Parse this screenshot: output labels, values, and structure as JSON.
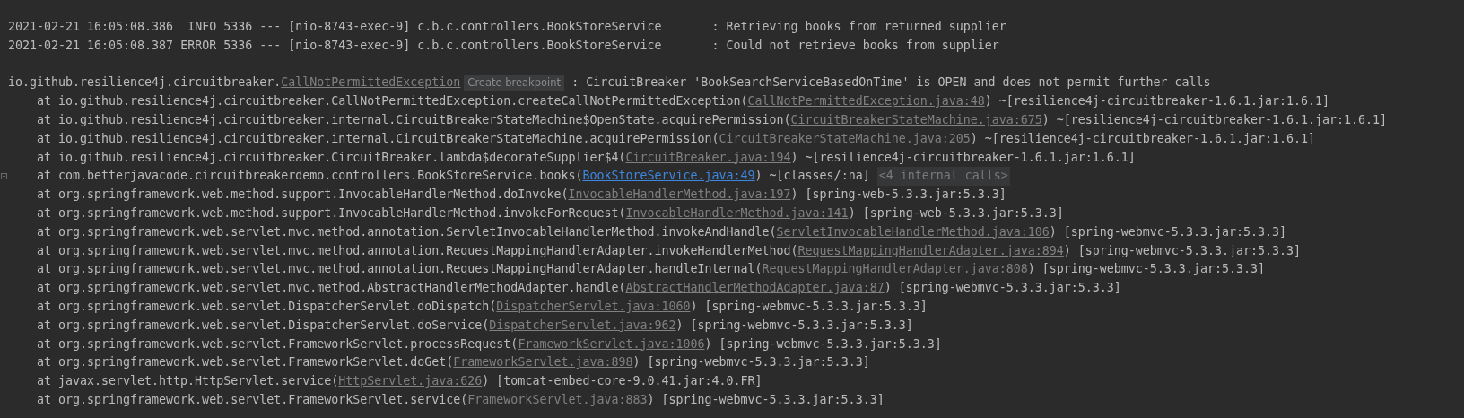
{
  "console": {
    "lines": [
      {
        "kind": "log",
        "segments": [
          {
            "kind": "plain",
            "text": "2021-02-21 16:05:08.386  INFO 5336 --- [nio-8743-exec-9] c.b.c.controllers.BookStoreService       : Retrieving books from returned supplier"
          }
        ]
      },
      {
        "kind": "log",
        "segments": [
          {
            "kind": "plain",
            "text": "2021-02-21 16:05:08.387 ERROR 5336 --- [nio-8743-exec-9] c.b.c.controllers.BookStoreService       : Could not retrieve books from supplier"
          }
        ]
      },
      {
        "kind": "exception",
        "segments": [
          {
            "kind": "plain",
            "text": "io.github.resilience4j.circuitbreaker."
          },
          {
            "kind": "link",
            "text": "CallNotPermittedException"
          },
          {
            "kind": "badge",
            "text": "Create breakpoint"
          },
          {
            "kind": "plain",
            "text": " : CircuitBreaker 'BookSearchServiceBasedOnTime' is OPEN and does not permit further calls"
          }
        ]
      },
      {
        "kind": "frame",
        "segments": [
          {
            "kind": "plain",
            "text": "at io.github.resilience4j.circuitbreaker.CallNotPermittedException.createCallNotPermittedException("
          },
          {
            "kind": "link",
            "text": "CallNotPermittedException.java:48"
          },
          {
            "kind": "plain",
            "text": ") ~[resilience4j-circuitbreaker-1.6.1.jar:1.6.1]"
          }
        ]
      },
      {
        "kind": "frame",
        "segments": [
          {
            "kind": "plain",
            "text": "at io.github.resilience4j.circuitbreaker.internal.CircuitBreakerStateMachine$OpenState.acquirePermission("
          },
          {
            "kind": "link",
            "text": "CircuitBreakerStateMachine.java:675"
          },
          {
            "kind": "plain",
            "text": ") ~[resilience4j-circuitbreaker-1.6.1.jar:1.6.1]"
          }
        ]
      },
      {
        "kind": "frame",
        "segments": [
          {
            "kind": "plain",
            "text": "at io.github.resilience4j.circuitbreaker.internal.CircuitBreakerStateMachine.acquirePermission("
          },
          {
            "kind": "link",
            "text": "CircuitBreakerStateMachine.java:205"
          },
          {
            "kind": "plain",
            "text": ") ~[resilience4j-circuitbreaker-1.6.1.jar:1.6.1]"
          }
        ]
      },
      {
        "kind": "frame",
        "segments": [
          {
            "kind": "plain",
            "text": "at io.github.resilience4j.circuitbreaker.CircuitBreaker.lambda$decorateSupplier$4("
          },
          {
            "kind": "link",
            "text": "CircuitBreaker.java:194"
          },
          {
            "kind": "plain",
            "text": ") ~[resilience4j-circuitbreaker-1.6.1.jar:1.6.1]"
          }
        ]
      },
      {
        "kind": "frame",
        "foldable": true,
        "segments": [
          {
            "kind": "plain",
            "text": "at com.betterjavacode.circuitbreakerdemo.controllers.BookStoreService.books("
          },
          {
            "kind": "project-link",
            "text": "BookStoreService.java:49"
          },
          {
            "kind": "plain",
            "text": ") ~[classes/:na] "
          },
          {
            "kind": "folded",
            "text": "<4 internal calls>"
          }
        ]
      },
      {
        "kind": "frame",
        "segments": [
          {
            "kind": "plain",
            "text": "at org.springframework.web.method.support.InvocableHandlerMethod.doInvoke("
          },
          {
            "kind": "link",
            "text": "InvocableHandlerMethod.java:197"
          },
          {
            "kind": "plain",
            "text": ") [spring-web-5.3.3.jar:5.3.3]"
          }
        ]
      },
      {
        "kind": "frame",
        "segments": [
          {
            "kind": "plain",
            "text": "at org.springframework.web.method.support.InvocableHandlerMethod.invokeForRequest("
          },
          {
            "kind": "link",
            "text": "InvocableHandlerMethod.java:141"
          },
          {
            "kind": "plain",
            "text": ") [spring-web-5.3.3.jar:5.3.3]"
          }
        ]
      },
      {
        "kind": "frame",
        "segments": [
          {
            "kind": "plain",
            "text": "at org.springframework.web.servlet.mvc.method.annotation.ServletInvocableHandlerMethod.invokeAndHandle("
          },
          {
            "kind": "link",
            "text": "ServletInvocableHandlerMethod.java:106"
          },
          {
            "kind": "plain",
            "text": ") [spring-webmvc-5.3.3.jar:5.3.3]"
          }
        ]
      },
      {
        "kind": "frame",
        "segments": [
          {
            "kind": "plain",
            "text": "at org.springframework.web.servlet.mvc.method.annotation.RequestMappingHandlerAdapter.invokeHandlerMethod("
          },
          {
            "kind": "link",
            "text": "RequestMappingHandlerAdapter.java:894"
          },
          {
            "kind": "plain",
            "text": ") [spring-webmvc-5.3.3.jar:5.3.3]"
          }
        ]
      },
      {
        "kind": "frame",
        "segments": [
          {
            "kind": "plain",
            "text": "at org.springframework.web.servlet.mvc.method.annotation.RequestMappingHandlerAdapter.handleInternal("
          },
          {
            "kind": "link",
            "text": "RequestMappingHandlerAdapter.java:808"
          },
          {
            "kind": "plain",
            "text": ") [spring-webmvc-5.3.3.jar:5.3.3]"
          }
        ]
      },
      {
        "kind": "frame",
        "segments": [
          {
            "kind": "plain",
            "text": "at org.springframework.web.servlet.mvc.method.AbstractHandlerMethodAdapter.handle("
          },
          {
            "kind": "link",
            "text": "AbstractHandlerMethodAdapter.java:87"
          },
          {
            "kind": "plain",
            "text": ") [spring-webmvc-5.3.3.jar:5.3.3]"
          }
        ]
      },
      {
        "kind": "frame",
        "segments": [
          {
            "kind": "plain",
            "text": "at org.springframework.web.servlet.DispatcherServlet.doDispatch("
          },
          {
            "kind": "link",
            "text": "DispatcherServlet.java:1060"
          },
          {
            "kind": "plain",
            "text": ") [spring-webmvc-5.3.3.jar:5.3.3]"
          }
        ]
      },
      {
        "kind": "frame",
        "segments": [
          {
            "kind": "plain",
            "text": "at org.springframework.web.servlet.DispatcherServlet.doService("
          },
          {
            "kind": "link",
            "text": "DispatcherServlet.java:962"
          },
          {
            "kind": "plain",
            "text": ") [spring-webmvc-5.3.3.jar:5.3.3]"
          }
        ]
      },
      {
        "kind": "frame",
        "segments": [
          {
            "kind": "plain",
            "text": "at org.springframework.web.servlet.FrameworkServlet.processRequest("
          },
          {
            "kind": "link",
            "text": "FrameworkServlet.java:1006"
          },
          {
            "kind": "plain",
            "text": ") [spring-webmvc-5.3.3.jar:5.3.3]"
          }
        ]
      },
      {
        "kind": "frame",
        "segments": [
          {
            "kind": "plain",
            "text": "at org.springframework.web.servlet.FrameworkServlet.doGet("
          },
          {
            "kind": "link",
            "text": "FrameworkServlet.java:898"
          },
          {
            "kind": "plain",
            "text": ") [spring-webmvc-5.3.3.jar:5.3.3]"
          }
        ]
      },
      {
        "kind": "frame",
        "segments": [
          {
            "kind": "plain",
            "text": "at javax.servlet.http.HttpServlet.service("
          },
          {
            "kind": "link",
            "text": "HttpServlet.java:626"
          },
          {
            "kind": "plain",
            "text": ") [tomcat-embed-core-9.0.41.jar:4.0.FR]"
          }
        ]
      },
      {
        "kind": "frame",
        "segments": [
          {
            "kind": "plain",
            "text": "at org.springframework.web.servlet.FrameworkServlet.service("
          },
          {
            "kind": "link",
            "text": "FrameworkServlet.java:883"
          },
          {
            "kind": "plain",
            "text": ") [spring-webmvc-5.3.3.jar:5.3.3]"
          }
        ]
      }
    ]
  }
}
